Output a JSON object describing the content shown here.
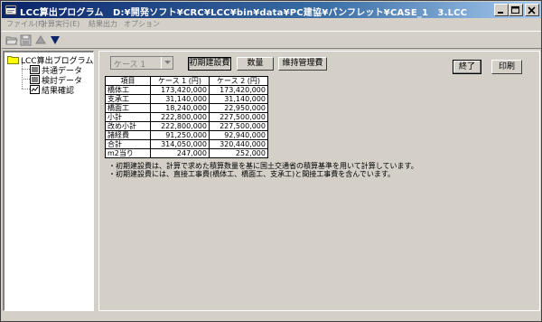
{
  "window": {
    "title": "LCC算出プログラム　D:¥開発ソフト¥CRC¥LCC¥bin¥data¥PC建協¥パンフレット¥CASE_1　3.LCC"
  },
  "menu": {
    "items": [
      {
        "label": "ファイル(F)"
      },
      {
        "label": "計算実行(E)"
      },
      {
        "label": "結果出力"
      },
      {
        "label": "オプション"
      }
    ]
  },
  "toolbar": {
    "icons": [
      "open-folder-icon",
      "save-icon",
      "up-arrow-icon",
      "down-arrow-icon"
    ]
  },
  "tree": {
    "root": "LCC算出プログラム",
    "children": [
      {
        "label": "共通データ"
      },
      {
        "label": "検討データ"
      },
      {
        "label": "結果確認"
      }
    ]
  },
  "controls": {
    "case_select": "ケース 1",
    "initial_cost_label": "初期建設費",
    "quantity_label": "数量",
    "maintenance_label": "維持管理費",
    "end_label": "終了",
    "print_label": "印刷"
  },
  "table": {
    "headers": [
      "項目",
      "ケース 1 (円)",
      "ケース 2 (円)"
    ],
    "rows": [
      {
        "item": "橋体工",
        "case1": "173,420,000",
        "case2": "173,420,000"
      },
      {
        "item": "支承工",
        "case1": "31,140,000",
        "case2": "31,140,000"
      },
      {
        "item": "橋面工",
        "case1": "18,240,000",
        "case2": "22,950,000"
      },
      {
        "item": "小計",
        "case1": "222,800,000",
        "case2": "227,500,000"
      },
      {
        "item": "改め小計",
        "case1": "222,800,000",
        "case2": "227,500,000"
      },
      {
        "item": "諸経費",
        "case1": "91,250,000",
        "case2": "92,940,000"
      },
      {
        "item": "合計",
        "case1": "314,050,000",
        "case2": "320,440,000"
      },
      {
        "item": "m2当り",
        "case1": "247,000",
        "case2": "252,000"
      }
    ]
  },
  "notes": [
    "・初期建設費は、計算で求めた積算数量を基に国土交通省の積算基準を用いて計算しています。",
    "・初期建設費には、直接工事費(橋体工、橋面工、支承工)と間接工事費を含んでいます。"
  ],
  "colors": {
    "titlebar_start": "#0a246a",
    "titlebar_end": "#a6caf0",
    "face": "#d4d0c8"
  }
}
